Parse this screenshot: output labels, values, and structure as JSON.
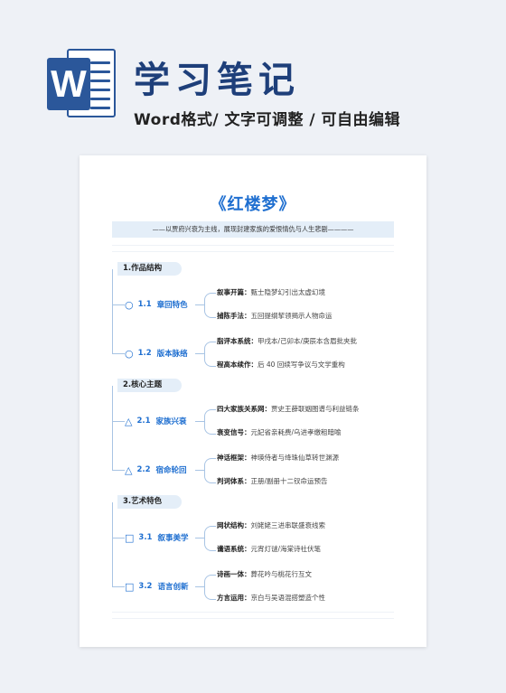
{
  "header": {
    "logo_letter": "W",
    "title": "学习笔记",
    "subtitle": "Word格式/ 文字可调整 / 可自由编辑"
  },
  "doc": {
    "title": "《红楼梦》",
    "banner": "——以贾府兴衰为主线，展现封建家族的爱恨情仇与人生悲剧————",
    "sections": [
      {
        "title": "1.作品结构",
        "nodes": [
          {
            "symbol": "○",
            "num": "1.1",
            "label": "章回特色",
            "leaves": [
              {
                "k": "叙事开篇：",
                "v": "甄士隐梦幻引出太虚幻境"
              },
              {
                "k": "捕陈手法：",
                "v": "五回提纲挈领揭示人物命运"
              }
            ]
          },
          {
            "symbol": "○",
            "num": "1.2",
            "label": "版本脉络",
            "leaves": [
              {
                "k": "脂评本系统：",
                "v": "甲戌本/己卯本/庚辰本含眉批夹批"
              },
              {
                "k": "程高本续作：",
                "v": "后 40 回续写争议与文学重构"
              }
            ]
          }
        ]
      },
      {
        "title": "2.核心主题",
        "nodes": [
          {
            "symbol": "△",
            "num": "2.1",
            "label": "家族兴衰",
            "leaves": [
              {
                "k": "四大家族关系网：",
                "v": "贾史王薛联姻图谱与利益链条"
              },
              {
                "k": "衰变信号：",
                "v": "元妃省亲耗费/乌进孝缴租暗喻"
              }
            ]
          },
          {
            "symbol": "△",
            "num": "2.2",
            "label": "宿命轮回",
            "leaves": [
              {
                "k": "神话框架：",
                "v": "神瑛侍者与绛珠仙草转世渊源"
              },
              {
                "k": "判词体系：",
                "v": "正册/副册十二钗命运预告"
              }
            ]
          }
        ]
      },
      {
        "title": "3.艺术特色",
        "nodes": [
          {
            "symbol": "□",
            "num": "3.1",
            "label": "叙事美学",
            "leaves": [
              {
                "k": "网状结构：",
                "v": "刘姥姥三进串联盛衰线索"
              },
              {
                "k": "谶语系统：",
                "v": "元宵灯谜/海棠诗社伏笔"
              }
            ]
          },
          {
            "symbol": "□",
            "num": "3.2",
            "label": "语言创新",
            "leaves": [
              {
                "k": "诗画一体：",
                "v": "葬花吟与桃花行互文"
              },
              {
                "k": "方言运用：",
                "v": "京白与吴语混搭塑造个性"
              }
            ]
          }
        ]
      }
    ]
  }
}
